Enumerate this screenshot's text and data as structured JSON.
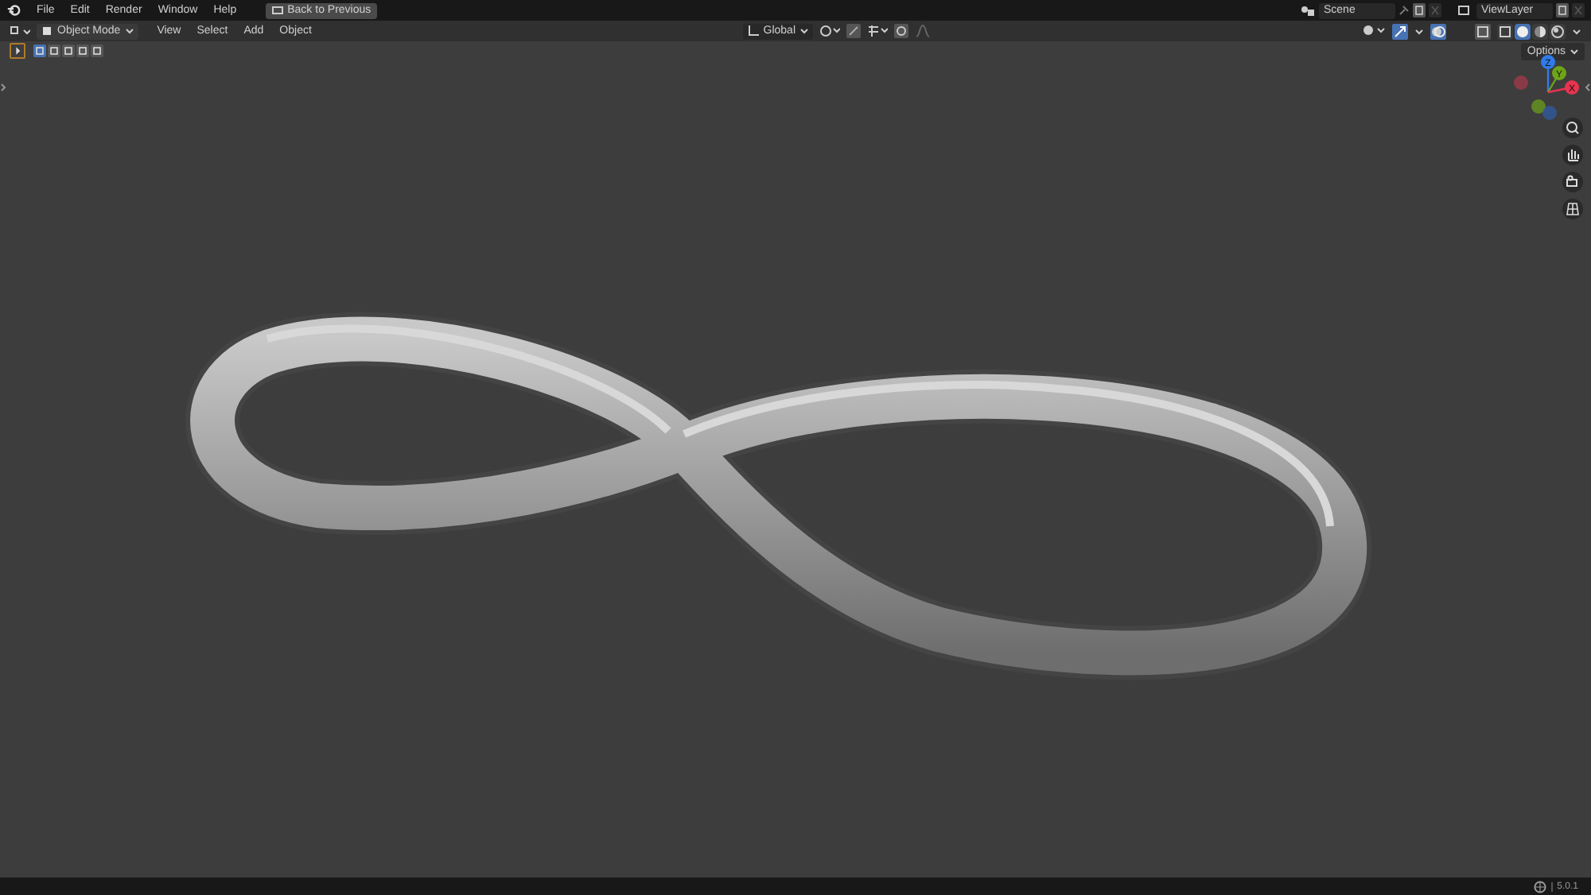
{
  "top_menu": [
    "File",
    "Edit",
    "Render",
    "Window",
    "Help"
  ],
  "back_button": "Back to Previous",
  "scene": {
    "label": "Scene"
  },
  "view_layer": {
    "label": "ViewLayer"
  },
  "header": {
    "mode": "Object Mode",
    "menus": [
      "View",
      "Select",
      "Add",
      "Object"
    ],
    "orientation": "Global",
    "snap_on": false,
    "proportional_on": false,
    "gizmo_on": true,
    "overlays_on": true,
    "xray_on": false
  },
  "shading_modes": [
    {
      "selected": false
    },
    {
      "selected": true
    },
    {
      "selected": false
    },
    {
      "selected": false
    }
  ],
  "select_modes": [
    {
      "selected": true
    },
    {
      "selected": false
    },
    {
      "selected": false
    },
    {
      "selected": false
    },
    {
      "selected": false
    }
  ],
  "options_button": "Options",
  "axes": [
    {
      "label": "Z",
      "color": "#2f7bea",
      "kind": "positive"
    },
    {
      "label": "Y",
      "color": "#6ea31a",
      "kind": "positive"
    },
    {
      "label": "X",
      "color": "#e8344f",
      "kind": "positive"
    },
    {
      "color": "#8a3a47",
      "kind": "negative"
    }
  ],
  "status_bar": {
    "version": "5.0.1"
  }
}
